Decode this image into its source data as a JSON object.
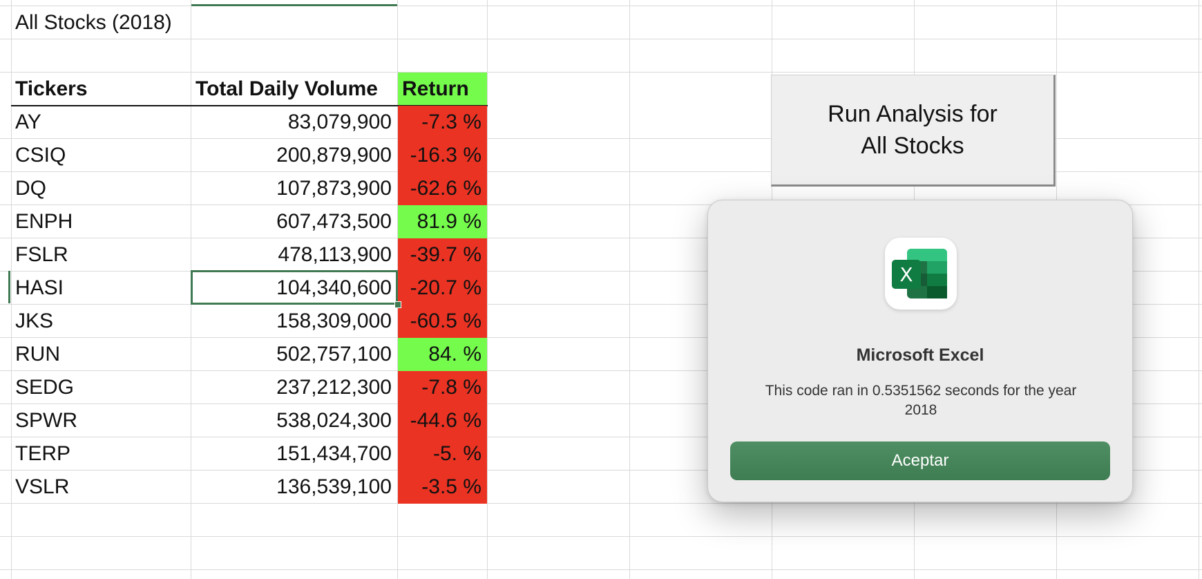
{
  "sheet": {
    "title": "All Stocks (2018)",
    "headers": {
      "ticker": "Tickers",
      "volume": "Total Daily Volume",
      "return": "Return"
    },
    "rows": [
      {
        "ticker": "AY",
        "volume": "83,079,900",
        "return": "-7.3 %",
        "positive": false
      },
      {
        "ticker": "CSIQ",
        "volume": "200,879,900",
        "return": "-16.3 %",
        "positive": false
      },
      {
        "ticker": "DQ",
        "volume": "107,873,900",
        "return": "-62.6 %",
        "positive": false
      },
      {
        "ticker": "ENPH",
        "volume": "607,473,500",
        "return": "81.9 %",
        "positive": true
      },
      {
        "ticker": "FSLR",
        "volume": "478,113,900",
        "return": "-39.7 %",
        "positive": false
      },
      {
        "ticker": "HASI",
        "volume": "104,340,600",
        "return": "-20.7 %",
        "positive": false
      },
      {
        "ticker": "JKS",
        "volume": "158,309,000",
        "return": "-60.5 %",
        "positive": false
      },
      {
        "ticker": "RUN",
        "volume": "502,757,100",
        "return": "84. %",
        "positive": true
      },
      {
        "ticker": "SEDG",
        "volume": "237,212,300",
        "return": "-7.8 %",
        "positive": false
      },
      {
        "ticker": "SPWR",
        "volume": "538,024,300",
        "return": "-44.6 %",
        "positive": false
      },
      {
        "ticker": "TERP",
        "volume": "151,434,700",
        "return": "-5. %",
        "positive": false
      },
      {
        "ticker": "VSLR",
        "volume": "136,539,100",
        "return": "-3.5 %",
        "positive": false
      }
    ],
    "colors": {
      "negative": "#ea3323",
      "positive": "#75fb4c",
      "selection": "#3f7a52"
    }
  },
  "macro_button": {
    "line1": "Run Analysis for",
    "line2": "All Stocks"
  },
  "dialog": {
    "icon": "excel-app-icon",
    "icon_letter": "X",
    "title": "Microsoft Excel",
    "message": "This code ran in 0.5351562 seconds for the year 2018",
    "ok_label": "Aceptar",
    "ok_color": "#3e7c52"
  }
}
